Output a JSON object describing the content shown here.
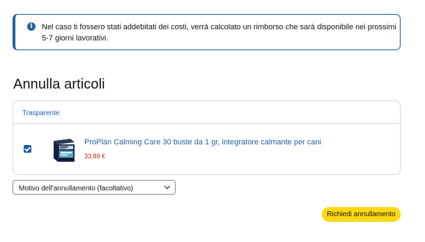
{
  "alert": {
    "icon": "info-icon",
    "text": "Nel caso ti fossero stati addebitati dei costi, verrà calcolato un rimborso che sarà disponibile nei prossimi 5-7 giorni lavorativi.",
    "accent_color": "#2162a1"
  },
  "page_title": "Annulla articoli",
  "items_box": {
    "header": "Trasparente",
    "items": [
      {
        "checked": true,
        "name": "ProPlan Calming Care 30 buste da 1 gr, integratore calmante per cani",
        "price": "33,89 €",
        "image": "product-package-thumbnail"
      }
    ]
  },
  "reason_select": {
    "selected": "Motivo dell'annullamento (facoltativo)",
    "icon": "chevron-down-icon"
  },
  "actions": {
    "submit_label": "Richiedi annullamento",
    "submit_color": "#ffd814"
  }
}
